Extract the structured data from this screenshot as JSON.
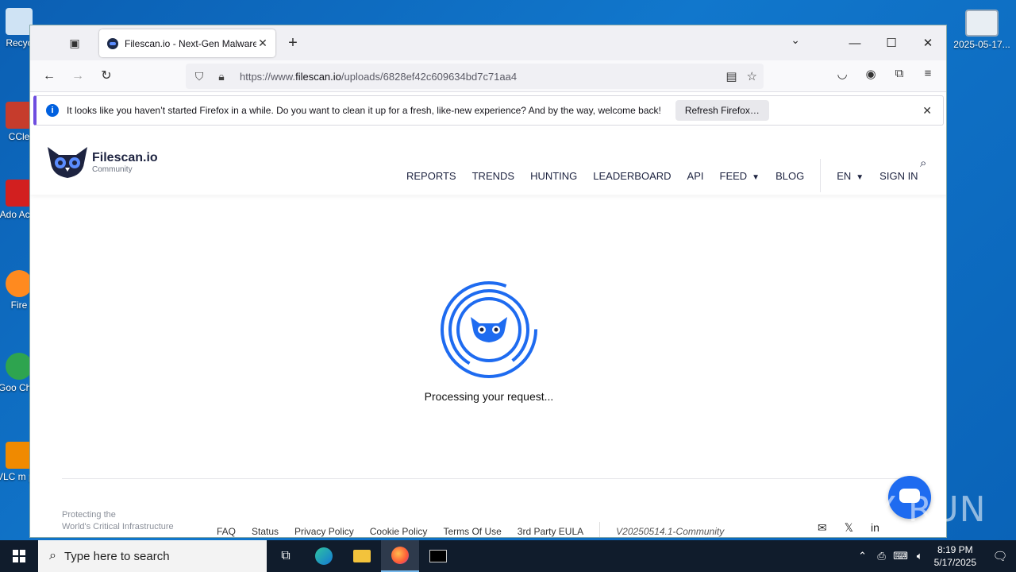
{
  "desktop": {
    "icons": [
      {
        "label": "Recyc",
        "color": "#d0e4f5"
      },
      {
        "label": "CCle",
        "color": "#c63c2c"
      },
      {
        "label": "Ado Acro",
        "color": "#d21f1f"
      },
      {
        "label": "Fire",
        "color": "#ff8a1f"
      },
      {
        "label": "Goo Chro",
        "color": "#2ea44f"
      },
      {
        "label": "VLC m pla",
        "color": "#f08a00"
      }
    ],
    "right_icon_label": "2025-05-17...",
    "watermark": "ANY RUN"
  },
  "browser": {
    "tab": {
      "title": "Filescan.io - Next-Gen Malware",
      "close": "✕"
    },
    "new_tab": "+",
    "window_controls": {
      "minimize": "—",
      "maximize": "☐",
      "close": "✕",
      "list": "⌄"
    },
    "url": {
      "prefix": "https://www.",
      "domain": "filescan.io",
      "path": "/uploads/6828ef42c609634bd7c71aa4"
    },
    "notice": {
      "text": "It looks like you haven’t started Firefox in a while. Do you want to clean it up for a fresh, like-new experience? And by the way, welcome back!",
      "button": "Refresh Firefox…",
      "close": "✕"
    }
  },
  "site": {
    "brand": {
      "name": "Filescan.io",
      "sub": "Community"
    },
    "menu": [
      "REPORTS",
      "TRENDS",
      "HUNTING",
      "LEADERBOARD",
      "API",
      "FEED",
      "BLOG"
    ],
    "language": "EN",
    "sign_in": "SIGN IN",
    "processing": "Processing your request...",
    "footer": {
      "tagline_1": "Protecting the",
      "tagline_2": "World's Critical Infrastructure",
      "links": [
        "FAQ",
        "Status",
        "Privacy Policy",
        "Cookie Policy",
        "Terms Of Use",
        "3rd Party EULA"
      ],
      "version": "V20250514.1-Community"
    },
    "colors": {
      "accent": "#1e6bf0",
      "navy": "#1d2340"
    }
  },
  "taskbar": {
    "search_placeholder": "Type here to search",
    "time": "8:19 PM",
    "date": "5/17/2025"
  }
}
